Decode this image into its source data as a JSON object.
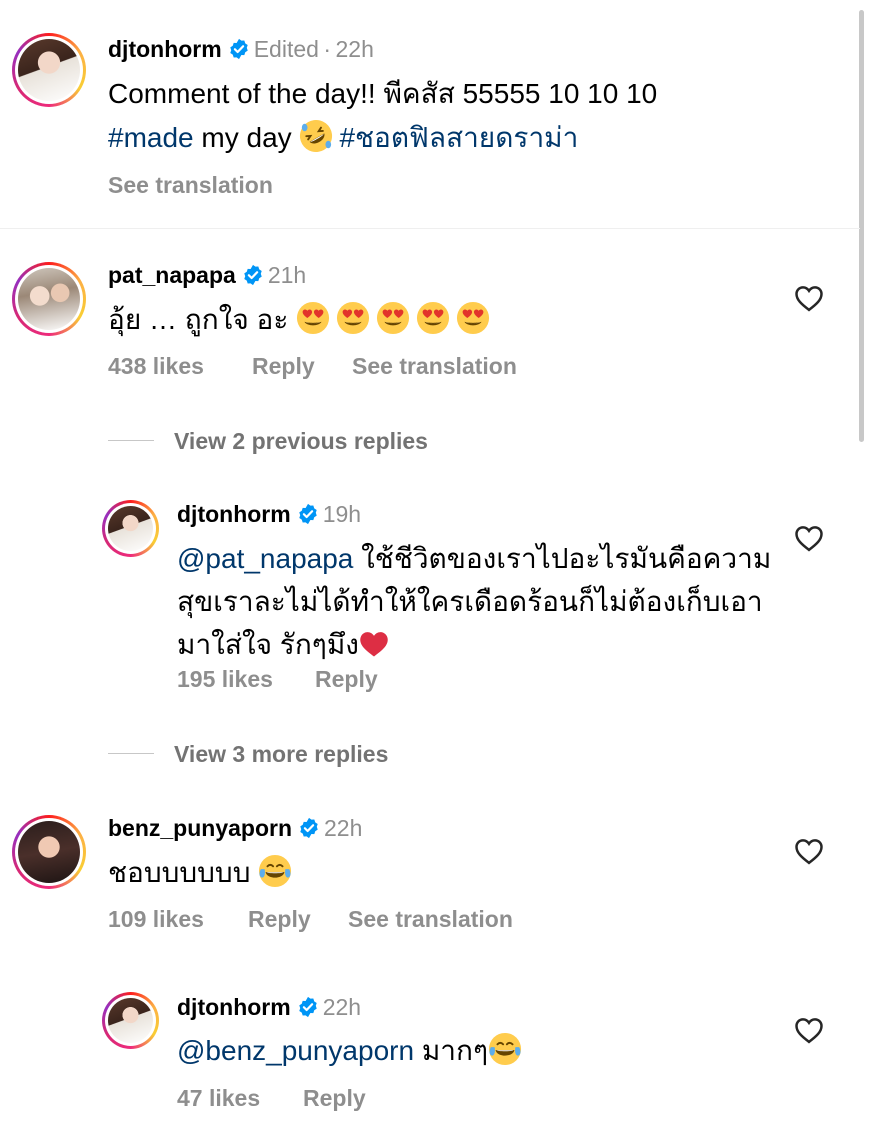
{
  "post": {
    "username": "djtonhorm",
    "edited_label": "Edited",
    "separator": "·",
    "time": "22h",
    "line1": "Comment of the day!! พีคสัส 55555 10 10 10",
    "hashtag1": "#made",
    "line2_text": " my day ",
    "hashtag2": "#ชอตฟิลสายดราม่า",
    "see_translation": "See translation"
  },
  "comments": [
    {
      "username": "pat_napapa",
      "time": "21h",
      "text": "อุ้ย … ถูกใจ อะ ",
      "likes": "438 likes",
      "reply": "Reply",
      "see_translation": "See translation"
    },
    {
      "username": "benz_punyaporn",
      "time": "22h",
      "text": "ชอบบบบบบ ",
      "likes": "109 likes",
      "reply": "Reply",
      "see_translation": "See translation"
    }
  ],
  "replies": [
    {
      "username": "djtonhorm",
      "time": "19h",
      "mention": "@pat_napapa",
      "line1": " ใช้ชีวิตของเราไปอะไรมันคือความ",
      "line2": "สุขเราละไม่ได้ทำให้ใครเดือดร้อนก็ไม่ต้องเก็บเอา",
      "line3": "มาใส่ใจ รักๆมึง",
      "likes": "195 likes",
      "reply": "Reply"
    },
    {
      "username": "djtonhorm",
      "time": "22h",
      "mention": "@benz_punyaporn",
      "text": " มากๆ",
      "likes": "47 likes",
      "reply": "Reply"
    }
  ],
  "view_previous": "View 2 previous replies",
  "view_more": "View 3 more replies",
  "colors": {
    "link": "#00376b",
    "muted": "#8e8e8e",
    "verified": "#0095f6",
    "heart_outline": "#262626"
  },
  "icons": [
    "verified-badge-icon",
    "heart-outline-icon",
    "heart-eyes-emoji",
    "rofl-emoji",
    "joy-emoji",
    "red-heart-emoji"
  ]
}
